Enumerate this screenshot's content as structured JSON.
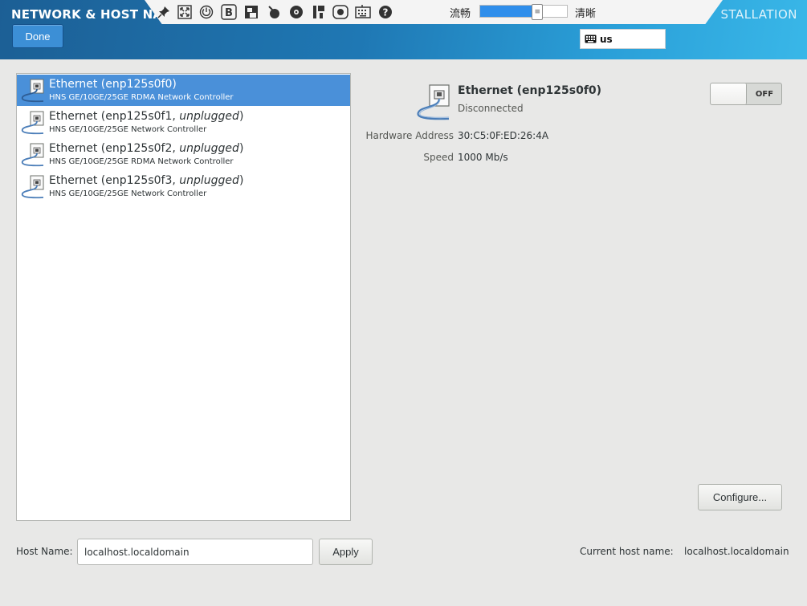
{
  "header": {
    "title": "NETWORK & HOST NA",
    "install_title": "STALLATION",
    "done_label": "Done",
    "keyboard_layout": "us"
  },
  "overlay_toolbar": {
    "icons": [
      "pin-icon",
      "fullscreen-icon",
      "power-icon",
      "bold-b-icon",
      "screenshot-icon",
      "mouse-icon",
      "disc-icon",
      "save-icon",
      "record-icon",
      "keyboard-icon",
      "help-icon"
    ],
    "quality_low_label": "流畅",
    "quality_high_label": "清晰",
    "quality_level": 0.66
  },
  "devices": [
    {
      "name": "Ethernet (enp125s0f0)",
      "status": "",
      "description": "HNS GE/10GE/25GE RDMA Network Controller",
      "selected": true
    },
    {
      "name": "Ethernet (enp125s0f1, ",
      "status": "unplugged",
      "suffix": ")",
      "description": "HNS GE/10GE/25GE Network Controller",
      "selected": false
    },
    {
      "name": "Ethernet (enp125s0f2, ",
      "status": "unplugged",
      "suffix": ")",
      "description": "HNS GE/10GE/25GE RDMA Network Controller",
      "selected": false
    },
    {
      "name": "Ethernet (enp125s0f3, ",
      "status": "unplugged",
      "suffix": ")",
      "description": "HNS GE/10GE/25GE Network Controller",
      "selected": false
    }
  ],
  "detail": {
    "name": "Ethernet (enp125s0f0)",
    "state": "Disconnected",
    "hardware_address_label": "Hardware Address",
    "hardware_address": "30:C5:0F:ED:26:4A",
    "speed_label": "Speed",
    "speed": "1000 Mb/s",
    "power_state": "OFF",
    "configure_label": "Configure..."
  },
  "hostname": {
    "label": "Host Name:",
    "value": "localhost.localdomain",
    "apply_label": "Apply",
    "current_label": "Current host name:",
    "current_value": "localhost.localdomain"
  }
}
